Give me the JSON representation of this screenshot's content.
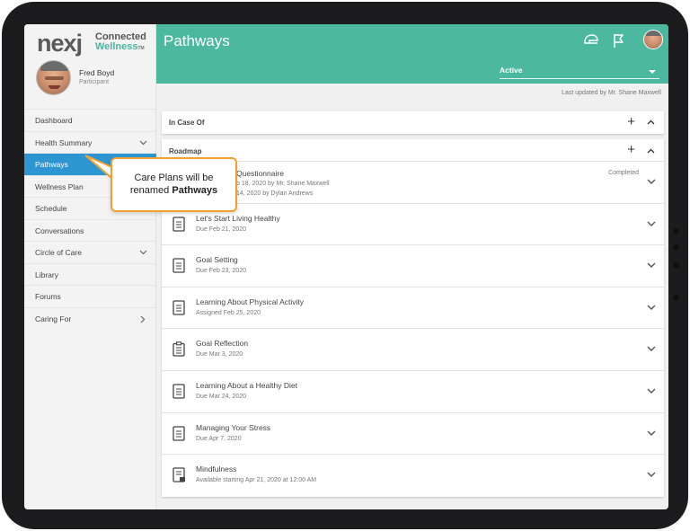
{
  "logo": {
    "brand": "nexj",
    "connected": "Connected",
    "wellness": "Wellness",
    "tm": "TM"
  },
  "profile": {
    "name": "Fred Boyd",
    "role": "Participant"
  },
  "sidebar": {
    "items": [
      {
        "label": "Dashboard",
        "chevron": ""
      },
      {
        "label": "Health Summary",
        "chevron": "⌄"
      },
      {
        "label": "Pathways",
        "chevron": ""
      },
      {
        "label": "Wellness Plan",
        "chevron": ""
      },
      {
        "label": "Schedule",
        "chevron": ""
      },
      {
        "label": "Conversations",
        "chevron": ""
      },
      {
        "label": "Circle of Care",
        "chevron": "⌄"
      },
      {
        "label": "Library",
        "chevron": ""
      },
      {
        "label": "Forums",
        "chevron": ""
      },
      {
        "label": "Caring For",
        "chevron": "›"
      }
    ]
  },
  "header": {
    "title": "Pathways",
    "icons": [
      "helmet-icon",
      "flag-icon"
    ],
    "filter_value": "Active"
  },
  "updated": "Last updated by Mr. Shane Maxwell",
  "panels": {
    "in_case_of": {
      "title": "In Case Of",
      "plus": "+",
      "caret": "^"
    },
    "roadmap": {
      "title": "Roadmap",
      "plus": "+",
      "caret": "^",
      "rows": [
        {
          "title": "Questionnaire",
          "sub1": "b 18, 2020 by Mr. Shane Maxwell",
          "sub2": "14, 2020 by Dylan Andrews",
          "status": "Completed",
          "icon": "document-icon"
        },
        {
          "title": "Let's Start Living Healthy",
          "sub1": "Due Feb 21, 2020",
          "status": "",
          "icon": "document-icon"
        },
        {
          "title": "Goal Setting",
          "sub1": "Due Feb 23, 2020",
          "status": "",
          "icon": "document-icon"
        },
        {
          "title": "Learning About Physical Activity",
          "sub1": "Assigned Feb 25, 2020",
          "status": "",
          "icon": "document-icon"
        },
        {
          "title": "Goal Reflection",
          "sub1": "Due Mar 3, 2020",
          "status": "",
          "icon": "clipboard-icon"
        },
        {
          "title": "Learning About a Healthy Diet",
          "sub1": "Due Mar 24, 2020",
          "status": "",
          "icon": "document-icon"
        },
        {
          "title": "Managing Your Stress",
          "sub1": "Due Apr 7, 2020",
          "status": "",
          "icon": "document-icon"
        },
        {
          "title": "Mindfulness",
          "sub1": "Available starting Apr 21, 2020 at 12:00 AM",
          "status": "",
          "icon": "locked-document-icon"
        }
      ]
    }
  },
  "callout": {
    "line1": "Care Plans will be",
    "line2_prefix": "renamed ",
    "line2_bold": "Pathways"
  },
  "colors": {
    "header": "#4cb8a0",
    "active_nav": "#2e95d3",
    "callout_border": "#f0a034"
  }
}
